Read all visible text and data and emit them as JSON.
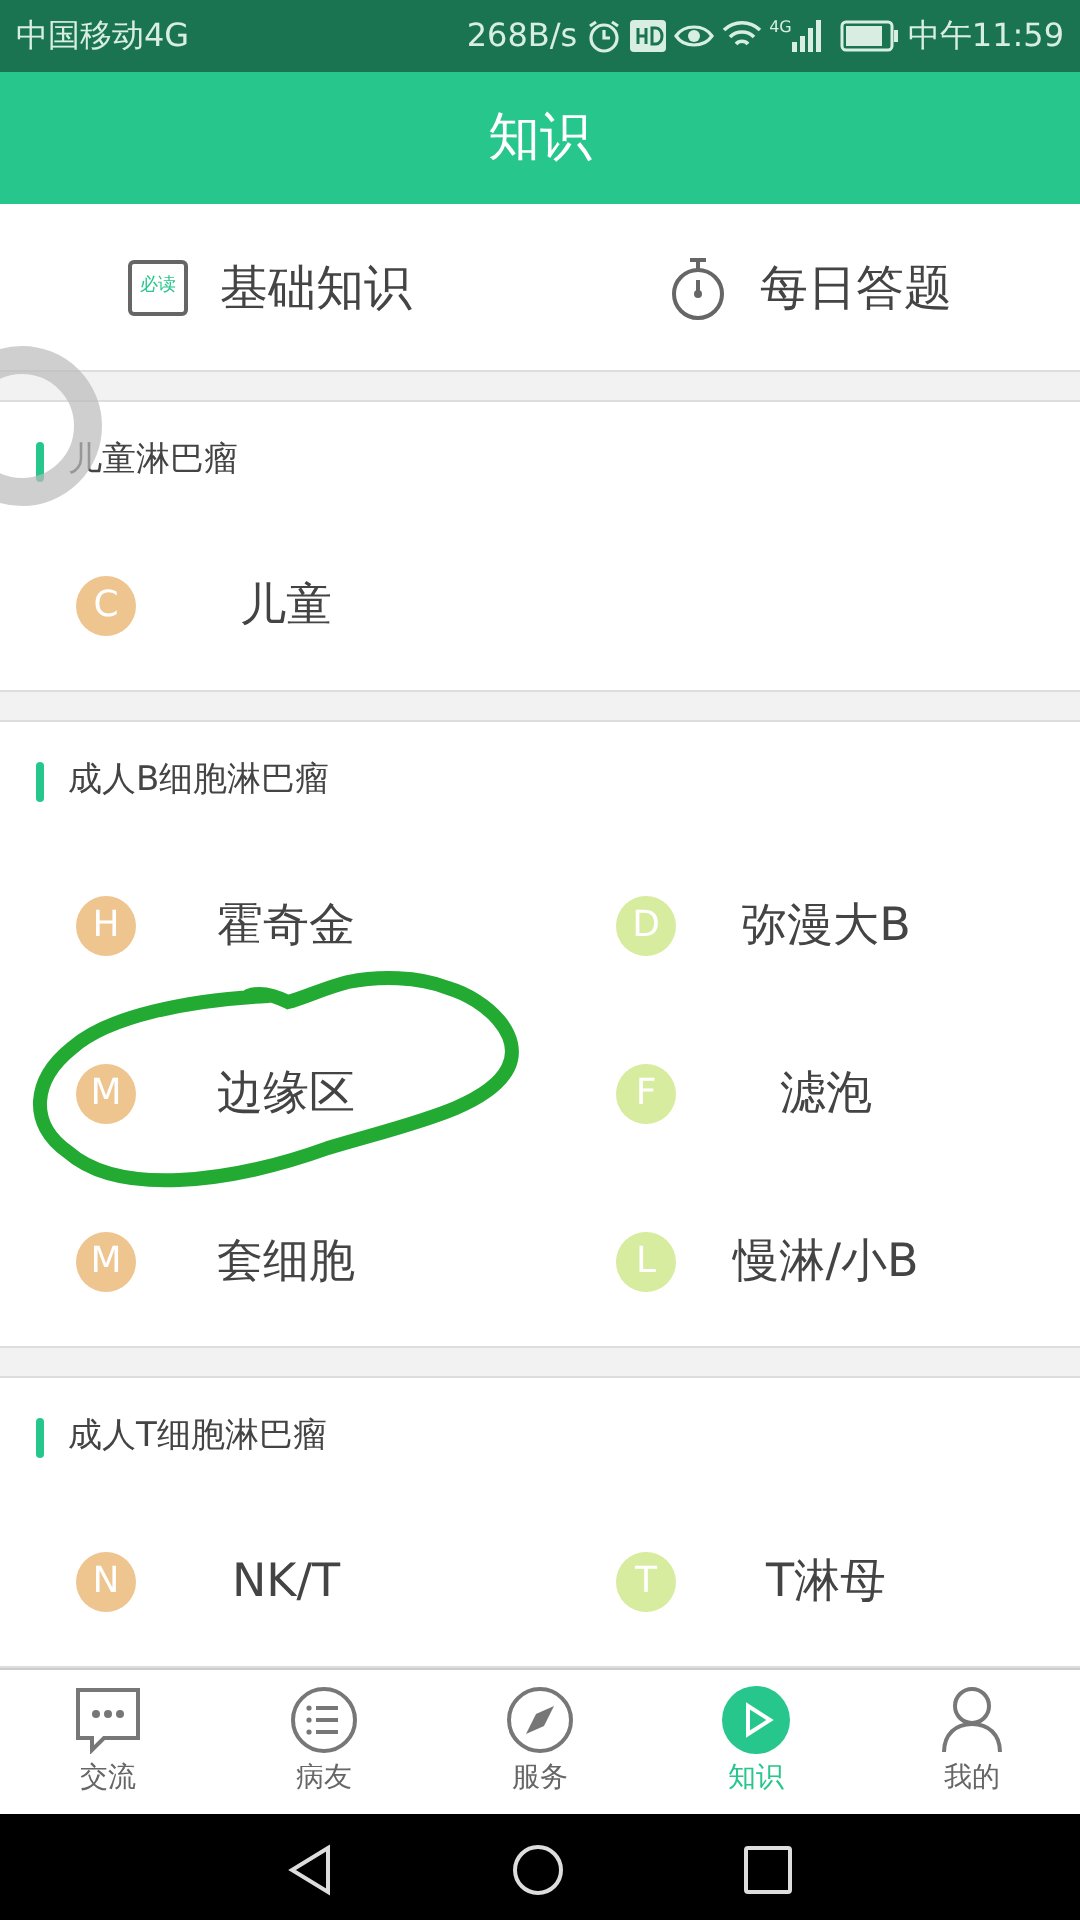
{
  "status_bar": {
    "carrier": "中国移动4G",
    "speed": "268B/s",
    "network": "4G",
    "time": "中午11:59"
  },
  "header": {
    "title": "知识"
  },
  "quick_links": [
    {
      "kind": "calendar",
      "label": "基础知识",
      "badge": "必读"
    },
    {
      "kind": "timer",
      "label": "每日答题"
    }
  ],
  "sections": [
    {
      "title": "儿童淋巴瘤",
      "items": [
        {
          "letter": "C",
          "label": "儿童",
          "color": "#eec48f"
        }
      ]
    },
    {
      "title": "成人B细胞淋巴瘤",
      "items": [
        {
          "letter": "H",
          "label": "霍奇金",
          "color": "#eec48f"
        },
        {
          "letter": "D",
          "label": "弥漫大B",
          "color": "#d7ec9e"
        },
        {
          "letter": "M",
          "label": "边缘区",
          "color": "#eec48f"
        },
        {
          "letter": "F",
          "label": "滤泡",
          "color": "#d7ec9e"
        },
        {
          "letter": "M",
          "label": "套细胞",
          "color": "#eec48f"
        },
        {
          "letter": "L",
          "label": "慢淋/小B",
          "color": "#d7ec9e"
        }
      ]
    },
    {
      "title": "成人T细胞淋巴瘤",
      "items": [
        {
          "letter": "N",
          "label": "NK/T",
          "color": "#eec48f"
        },
        {
          "letter": "T",
          "label": "T淋母",
          "color": "#d7ec9e"
        }
      ]
    }
  ],
  "tab_bar": [
    {
      "kind": "chat",
      "label": "交流",
      "selected": false
    },
    {
      "kind": "list",
      "label": "病友",
      "selected": false
    },
    {
      "kind": "compass",
      "label": "服务",
      "selected": false
    },
    {
      "kind": "play",
      "label": "知识",
      "selected": true
    },
    {
      "kind": "user",
      "label": "我的",
      "selected": false
    }
  ]
}
